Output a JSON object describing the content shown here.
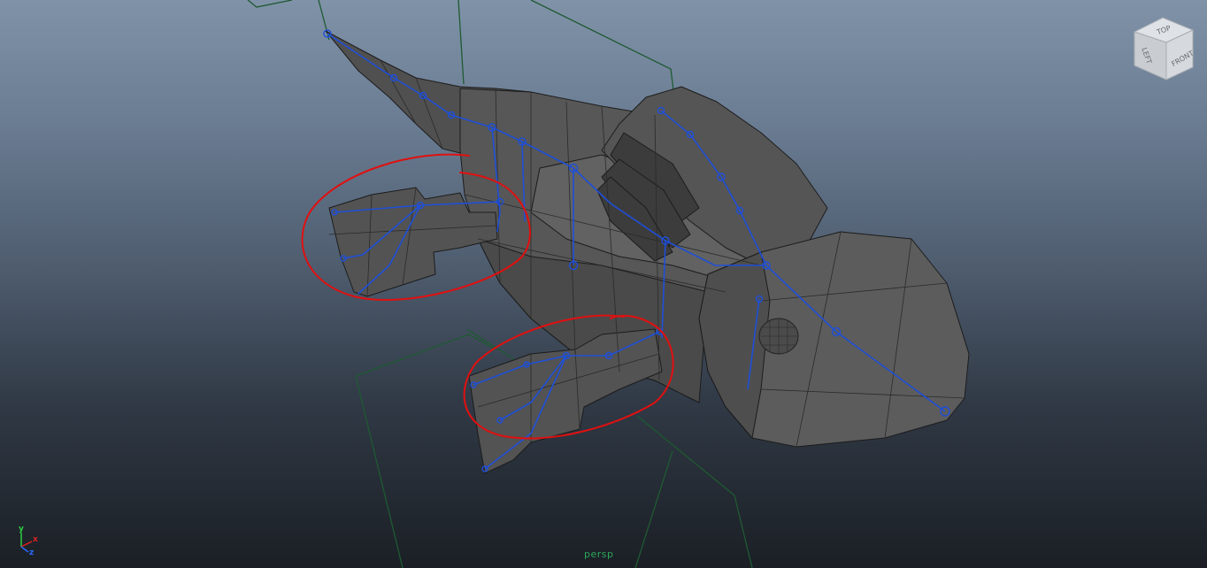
{
  "viewport": {
    "camera_name": "persp"
  },
  "view_cube": {
    "top_label": "TOP",
    "left_label": "LEFT",
    "front_label": "FRONT"
  },
  "axis_gizmo": {
    "x_label": "x",
    "y_label": "y",
    "z_label": "z"
  },
  "colors": {
    "background_top": "#8092a8",
    "background_bottom": "#1b1f25",
    "mesh": "#555555",
    "wireframe": "#1c1c1c",
    "joints": "#1e4fd8",
    "annotation": "#e01010",
    "camera_guides": "#1e5a32",
    "camera_label": "#2aa85a"
  }
}
